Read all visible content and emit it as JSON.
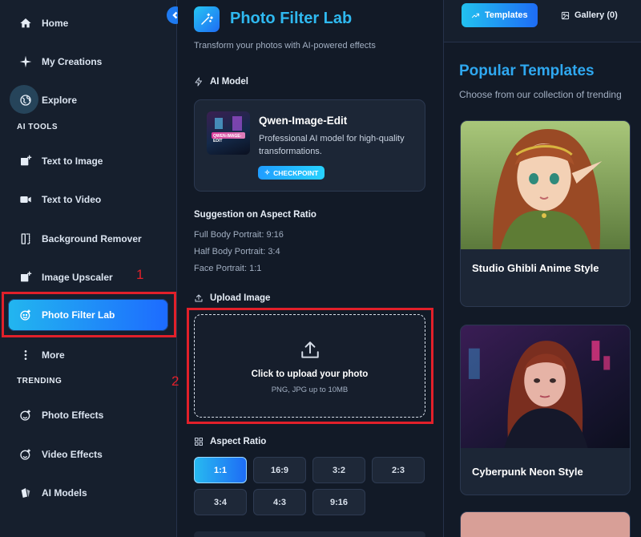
{
  "sidebar": {
    "items": [
      {
        "label": "Home",
        "icon": "home-icon"
      },
      {
        "label": "My Creations",
        "icon": "sparkle-icon"
      },
      {
        "label": "Explore",
        "icon": "globe-icon"
      },
      {
        "label": "Text to Image",
        "icon": "image-plus-icon"
      },
      {
        "label": "Text to Video",
        "icon": "video-icon"
      },
      {
        "label": "Background Remover",
        "icon": "crop-icon"
      },
      {
        "label": "Image Upscaler",
        "icon": "image-upscale-icon"
      },
      {
        "label": "Photo Filter Lab",
        "icon": "filter-face-icon"
      },
      {
        "label": "More",
        "icon": "more-vertical-icon"
      },
      {
        "label": "Photo Effects",
        "icon": "photo-effects-icon"
      },
      {
        "label": "Video Effects",
        "icon": "video-effects-icon"
      },
      {
        "label": "AI Models",
        "icon": "ai-models-icon"
      }
    ],
    "section_ai_tools": "AI TOOLS",
    "section_trending": "TRENDING",
    "active_item": "Photo Filter Lab"
  },
  "annotations": {
    "one": "1",
    "two": "2",
    "color": "#e2202a"
  },
  "main": {
    "title": "Photo Filter Lab",
    "subtitle": "Transform your photos with AI-powered effects",
    "ai_model_label": "AI Model",
    "model": {
      "name": "Qwen-Image-Edit",
      "description": "Professional AI model for high-quality transformations.",
      "badge": "CHECKPOINT",
      "thumb_text": "QWEN-IMAGE-EDIT"
    },
    "suggestion": {
      "title": "Suggestion on Aspect Ratio",
      "lines": [
        "Full Body Portrait: 9:16",
        "Half Body Portrait: 3:4",
        "Face Portrait: 1:1"
      ]
    },
    "upload": {
      "label": "Upload Image",
      "main_text": "Click to upload your photo",
      "sub_text": "PNG, JPG up to 10MB"
    },
    "aspect_ratio": {
      "label": "Aspect Ratio",
      "options": [
        "1:1",
        "16:9",
        "3:2",
        "2:3",
        "3:4",
        "4:3",
        "9:16"
      ],
      "selected": "1:1"
    }
  },
  "right": {
    "tabs": [
      {
        "label": "Templates",
        "icon": "trending-icon"
      },
      {
        "label": "Gallery (0)",
        "icon": "gallery-icon"
      }
    ],
    "active_tab": "Templates",
    "title": "Popular Templates",
    "subtitle": "Choose from our collection of trending",
    "templates": [
      {
        "name": "Studio Ghibli Anime Style"
      },
      {
        "name": "Cyberpunk Neon Style"
      }
    ]
  },
  "colors": {
    "accent": "#2fb9f0",
    "accent_blue": "#1e6cf5",
    "bg": "#121a27"
  }
}
